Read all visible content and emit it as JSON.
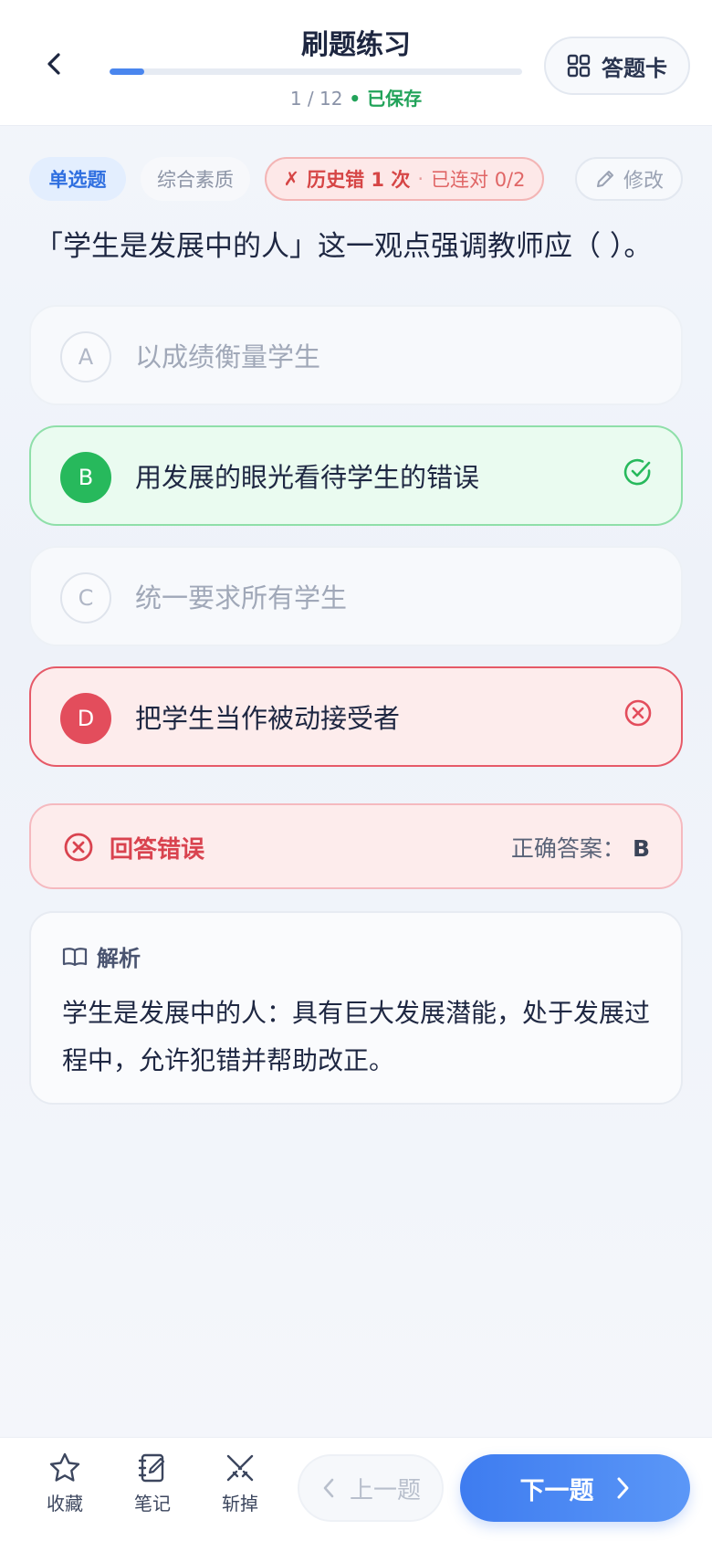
{
  "header": {
    "title": "刷题练习",
    "progress_text": "1 / 12",
    "progress_sep": " • ",
    "saved_text": "已保存",
    "progress_fraction": 0.0833,
    "answer_card_label": "答题卡"
  },
  "tags": {
    "type": "单选题",
    "category": "综合素质",
    "history_prefix": "✗",
    "history_error": "历史错 1 次",
    "history_dot": "·",
    "history_streak": "已连对 0/2",
    "edit_label": "修改"
  },
  "question": "「学生是发展中的人」这一观点强调教师应（ ）。",
  "options": [
    {
      "letter": "A",
      "text": "以成绩衡量学生",
      "state": "dim"
    },
    {
      "letter": "B",
      "text": "用发展的眼光看待学生的错误",
      "state": "correct"
    },
    {
      "letter": "C",
      "text": "统一要求所有学生",
      "state": "dim"
    },
    {
      "letter": "D",
      "text": "把学生当作被动接受者",
      "state": "wrong"
    }
  ],
  "result": {
    "label": "回答错误",
    "answer_label": "正确答案：",
    "answer_value": "B"
  },
  "explanation": {
    "title": "解析",
    "body": "学生是发展中的人：具有巨大发展潜能，处于发展过程中，允许犯错并帮助改正。"
  },
  "bottom": {
    "favorite_label": "收藏",
    "note_label": "笔记",
    "cut_label": "斩掉",
    "prev_label": "上一题",
    "next_label": "下一题"
  },
  "colors": {
    "accent": "#4a86ee",
    "correct": "#27b95c",
    "wrong": "#e34d5c"
  }
}
